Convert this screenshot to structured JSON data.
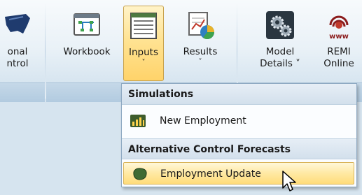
{
  "ribbon": {
    "buttons": [
      {
        "id": "regional-control",
        "label": "onal\nntrol",
        "icon": "map-icon",
        "interactable": true
      },
      {
        "id": "workbook",
        "label": "Workbook",
        "icon": "workbook-icon",
        "interactable": true
      },
      {
        "id": "inputs",
        "label": "Inputs",
        "chevron": "˅",
        "icon": "inputs-icon",
        "pressed": true
      },
      {
        "id": "results",
        "label": "Results",
        "chevron": "˅",
        "icon": "results-chart-icon"
      },
      {
        "id": "model-details",
        "label": "Model\nDetails ˅",
        "icon": "model-gear-icon"
      },
      {
        "id": "remi-online",
        "label": "REMI\nOnline",
        "icon": "remi-www-icon",
        "www": "www"
      }
    ]
  },
  "dropdown": {
    "sections": [
      {
        "header": "Simulations",
        "items": [
          {
            "label": "New Employment",
            "icon": "employment-chart-icon"
          }
        ]
      },
      {
        "header": "Alternative Control Forecasts",
        "items": [
          {
            "label": "Employment Update",
            "icon": "employment-update-icon",
            "hovered": true
          }
        ]
      }
    ]
  },
  "colors": {
    "accent": "#ffd36a",
    "ribbon_bg": "#e9f1f7"
  }
}
